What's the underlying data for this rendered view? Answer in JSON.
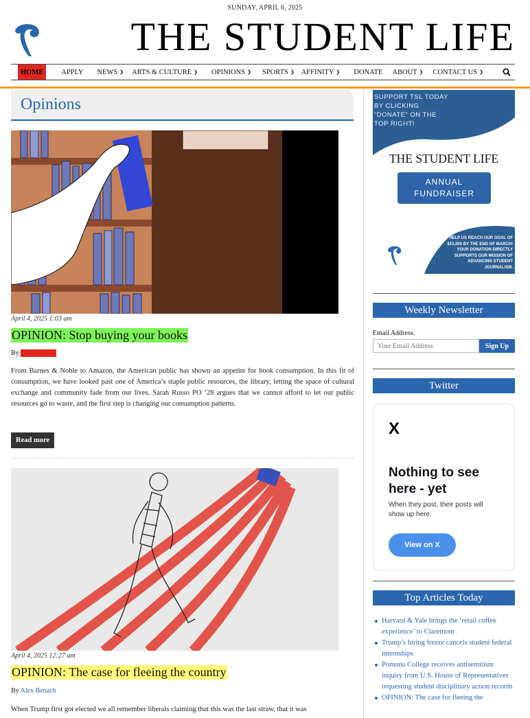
{
  "dateline": "SUNDAY, APRIL 6, 2025",
  "masthead": {
    "title": "THE STUDENT LIFE",
    "logo_icon": "tsl-quill-logo-icon"
  },
  "nav": {
    "items": [
      {
        "label": "HOME",
        "dropdown": false,
        "active": true
      },
      {
        "label": "APPLY",
        "dropdown": false
      },
      {
        "label": "NEWS",
        "dropdown": true
      },
      {
        "label": "ARTS & CULTURE",
        "dropdown": true
      },
      {
        "label": "OPINIONS",
        "dropdown": true
      },
      {
        "label": "SPORTS",
        "dropdown": true
      },
      {
        "label": "AFFINITY",
        "dropdown": true
      },
      {
        "label": "DONATE",
        "dropdown": false
      },
      {
        "label": "ABOUT",
        "dropdown": true
      },
      {
        "label": "CONTACT US",
        "dropdown": true
      }
    ],
    "search_icon": "search-icon",
    "accent": "#f29b2b"
  },
  "section": {
    "title": "Opinions",
    "color": "#2a66ad"
  },
  "articles": [
    {
      "date": "April 4, 2025 1:03 am",
      "headline": "OPINION: Stop buying your books",
      "by_prefix": "By",
      "author": "",
      "excerpt": "From Barnes & Noble to Amazon, the American public has shown an appetite for book consumption. In this fit of consumption, we have looked past one of America’s staple public resources, the library, letting the space of cultural exchange and community fade from our lives. Sarah Russo PO ’28 argues that we cannot afford to let our public resources go to waste, and the first step is changing our consumption patterns.",
      "read_more": "Read more",
      "image": "library-bookshelf-illustration"
    },
    {
      "date": "April 4, 2025 12:27 am",
      "headline": "OPINION: The case for fleeing the country",
      "by_prefix": "By",
      "author": "Alex Benach",
      "excerpt": "When Trump first got elected we all remember liberals claiming that this was the last straw, that it was",
      "image": "figure-running-on-flag-illustration"
    }
  ],
  "ad": {
    "top_text": "SUPPORT TSL TODAY BY CLICKING “DONATE” ON THE TOP RIGHT!",
    "title": "THE STUDENT LIFE",
    "badge_line1": "ANNUAL",
    "badge_line2": "FUNDRAISER",
    "bottom_text": "HELP US REACH OUR GOAL OF $15,000 BY THE END OF MARCH! YOUR DONATION DIRECTLY SUPPORTS OUR MISSION OF ADVANCING STUDENT JOURNALISM."
  },
  "newsletter": {
    "title": "Weekly Newsletter",
    "label": "Email Address:",
    "placeholder": "Your Email Address",
    "button": "Sign Up"
  },
  "twitter": {
    "title": "Twitter",
    "logo": "X",
    "heading": "Nothing to see here - yet",
    "sub": "When they post, their posts will show up here.",
    "button": "View on X"
  },
  "top_articles": {
    "title": "Top Articles Today",
    "items": [
      "Harvard & Yale brings the ‘retail coffee experience’ to Claremont",
      "Trump’s hiring freeze cancels student federal internships",
      "Pomona College receives antisemitism inquiry from U.S. House of Representatives requesting student disciplinary action records",
      "OPINION: The case for fleeing the"
    ]
  }
}
